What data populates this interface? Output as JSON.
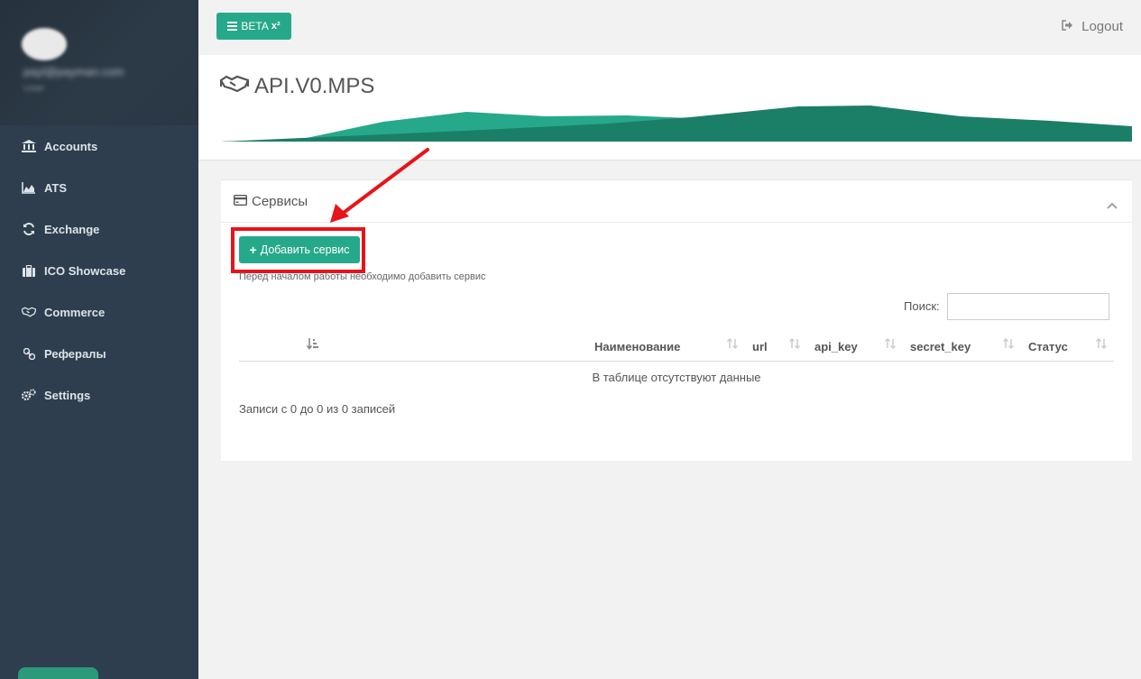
{
  "sidebar": {
    "profile": {
      "email": "payl@payman.com",
      "role": "User"
    },
    "items": [
      {
        "label": "Accounts",
        "icon": "bank-icon"
      },
      {
        "label": "ATS",
        "icon": "area-chart-icon"
      },
      {
        "label": "Exchange",
        "icon": "refresh-icon"
      },
      {
        "label": "ICO Showcase",
        "icon": "briefcase-icon"
      },
      {
        "label": "Commerce",
        "icon": "handshake-icon"
      },
      {
        "label": "Рефералы",
        "icon": "link-icon"
      },
      {
        "label": "Settings",
        "icon": "cogs-icon"
      }
    ]
  },
  "topbar": {
    "beta_label": "BETA",
    "beta_sup": "x²",
    "logout_label": "Logout"
  },
  "header": {
    "title": "API.V0.MPS",
    "accent": "#26a98a",
    "accent_dark": "#1b7f67"
  },
  "card": {
    "title": "Сервисы",
    "add_button": "Добавить сервис",
    "hint": "Перед началом работы необходимо добавить сервис",
    "search_label": "Поиск:",
    "search_value": "",
    "columns": [
      "Наименование",
      "url",
      "api_key",
      "secret_key",
      "Статус"
    ],
    "empty_text": "В таблице отсутствуют данные",
    "records_info": "Записи с 0 до 0 из 0 записей"
  },
  "annotation": {
    "color": "#e8141a"
  }
}
